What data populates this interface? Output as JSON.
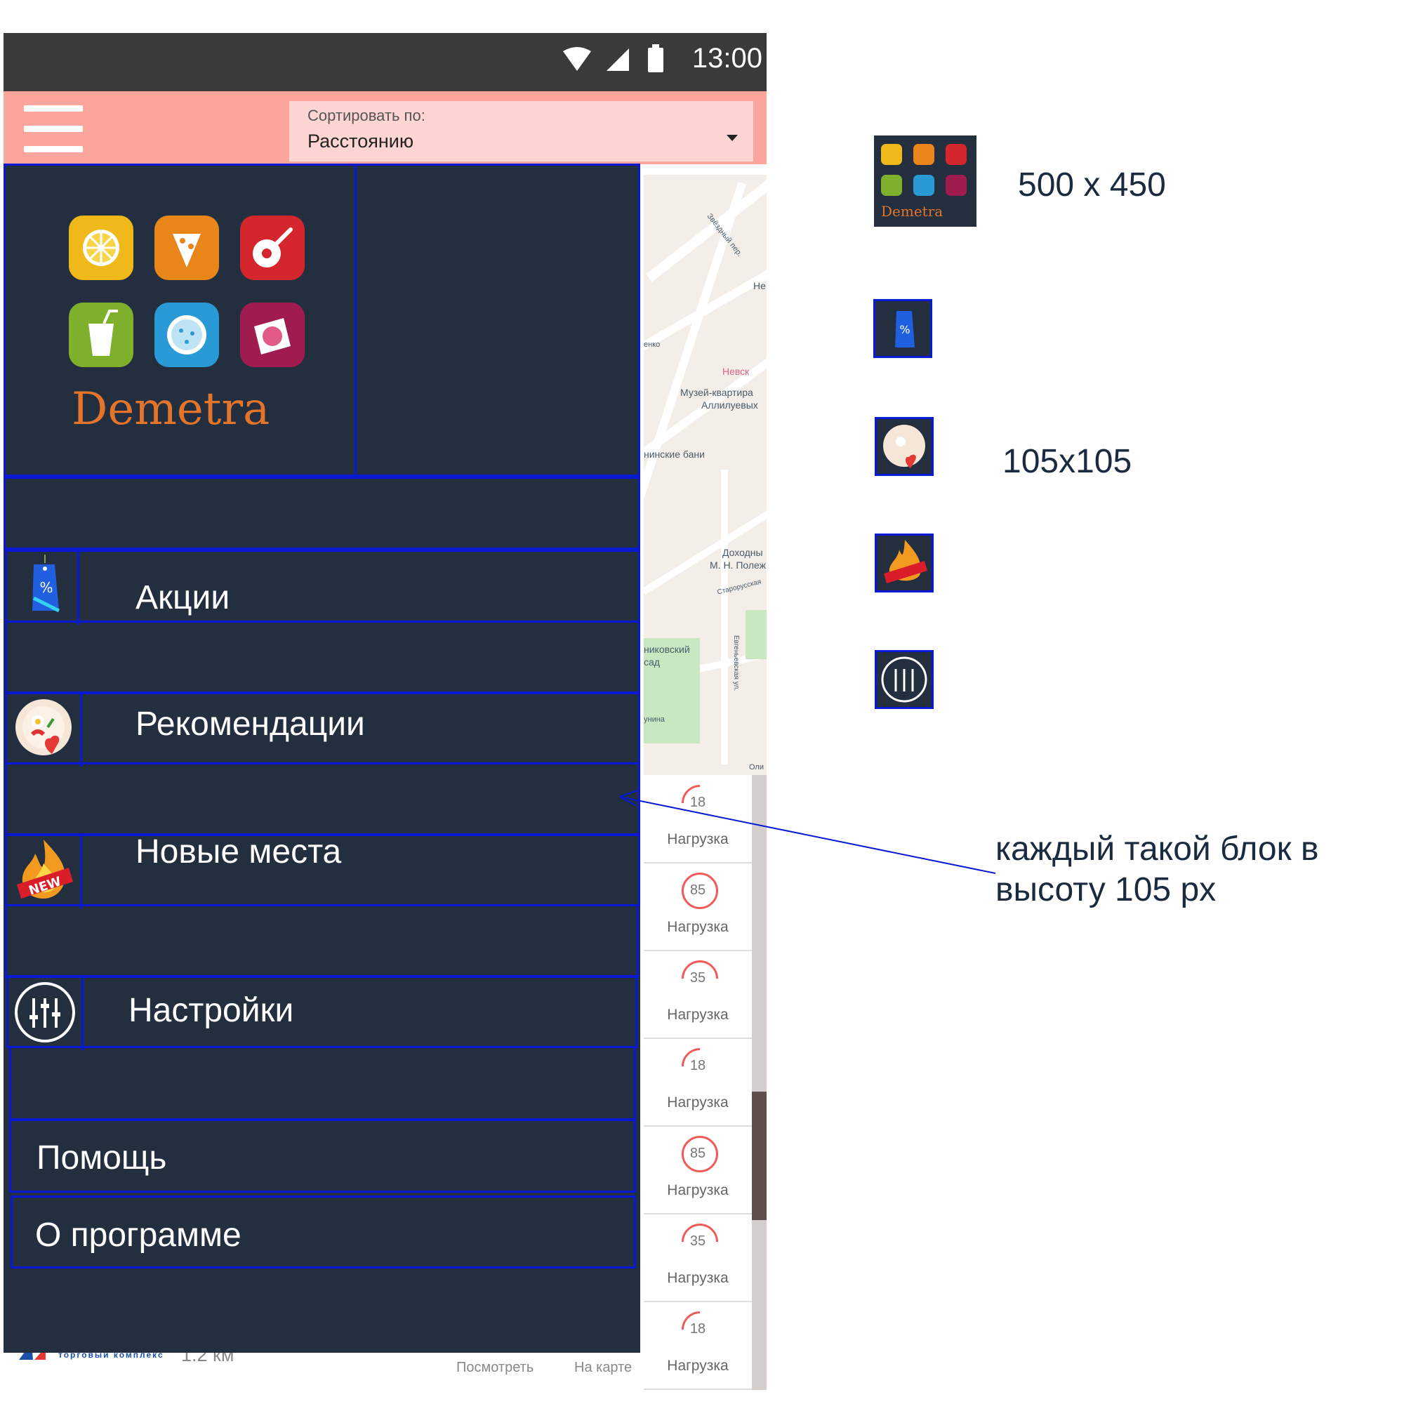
{
  "status_bar": {
    "time": "13:00"
  },
  "sort": {
    "label": "Сортировать по:",
    "value": "Расстоянию"
  },
  "drawer": {
    "brand": "Demetra",
    "menu": [
      {
        "label": "Акции",
        "icon": "discount-tag-icon"
      },
      {
        "label": "Рекомендации",
        "icon": "recommendation-plate-icon"
      },
      {
        "label": "Новые места",
        "icon": "new-fire-icon"
      },
      {
        "label": "Настройки",
        "icon": "settings-sliders-icon"
      }
    ],
    "help": "Помощь",
    "about": "О программе"
  },
  "map": {
    "labels": [
      "Звёздный пер.",
      "Не",
      "енко",
      "Невск",
      "Музей-квартира",
      "Аллилуевых",
      "нинские бани",
      "Доходны",
      "М. Н. Полеж",
      "Старорусская",
      "никовский",
      "сад",
      "Евгеньевская ул.",
      "унина",
      "Оли"
    ]
  },
  "list": {
    "rows": [
      {
        "value": "18",
        "label": "Нагрузка",
        "level": 0.18
      },
      {
        "value": "85",
        "label": "Нагрузка",
        "level": 0.85
      },
      {
        "value": "35",
        "label": "Нагрузка",
        "level": 0.35
      },
      {
        "value": "18",
        "label": "Нагрузка",
        "level": 0.18
      },
      {
        "value": "85",
        "label": "Нагрузка",
        "level": 0.85
      },
      {
        "value": "35",
        "label": "Нагрузка",
        "level": 0.35
      },
      {
        "value": "18",
        "label": "Нагрузка",
        "level": 0.18
      }
    ]
  },
  "bottom_peek": {
    "store_caption": "торговый комплекс",
    "distance": "1.2 км",
    "view": "Посмотреть",
    "on_map": "На карте"
  },
  "annotations": {
    "logo_size": "500 x 450",
    "icon_size": "105x105",
    "block_note_1": "каждый такой блок в",
    "block_note_2": "высоту 105 px"
  },
  "colors": {
    "status_bar": "#3a3a3a",
    "app_bar": "#fca59d",
    "drawer": "#232f3f",
    "outline": "#0a19d6",
    "gauge": "#f25a5a"
  }
}
